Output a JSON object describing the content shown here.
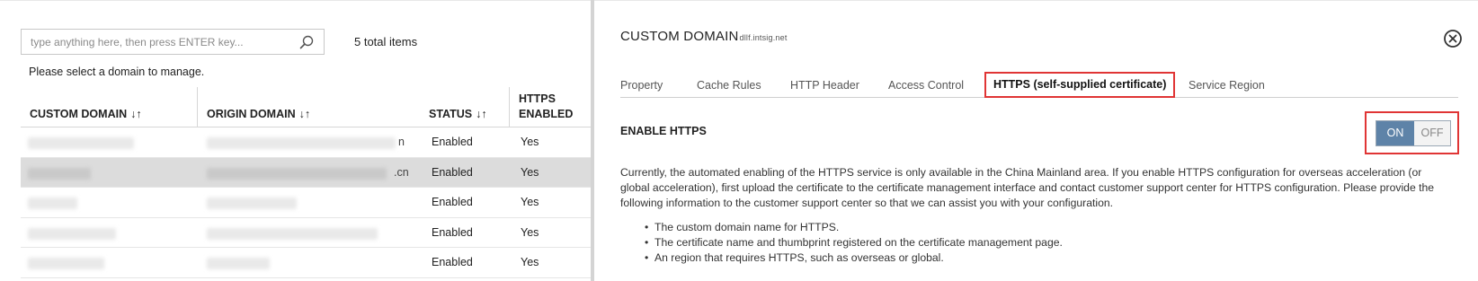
{
  "left": {
    "search": {
      "placeholder": "type anything here, then press ENTER key...",
      "value": ""
    },
    "total_items": "5 total items",
    "select_message": "Please select a domain to manage.",
    "columns": [
      {
        "label": "CUSTOM DOMAIN",
        "sort": "↓↑"
      },
      {
        "label": "ORIGIN DOMAIN",
        "sort": "↓↑"
      },
      {
        "label": "STATUS",
        "sort": "↓↑"
      },
      {
        "label_line1": "HTTPS",
        "label_line2": "ENABLED"
      }
    ],
    "rows": [
      {
        "origin_tail": "n",
        "status": "Enabled",
        "https": "Yes",
        "selected": false
      },
      {
        "origin_tail": ".cn",
        "status": "Enabled",
        "https": "Yes",
        "selected": true
      },
      {
        "origin_tail": "",
        "status": "Enabled",
        "https": "Yes",
        "selected": false
      },
      {
        "origin_tail": "",
        "status": "Enabled",
        "https": "Yes",
        "selected": false
      },
      {
        "origin_tail": "",
        "status": "Enabled",
        "https": "Yes",
        "selected": false
      }
    ]
  },
  "panel": {
    "title": "CUSTOM DOMAIN",
    "subtitle": "dllf.intsig.net",
    "tabs": [
      {
        "label": "Property"
      },
      {
        "label": "Cache Rules"
      },
      {
        "label": "HTTP Header"
      },
      {
        "label": "Access Control"
      },
      {
        "label": "HTTPS (self-supplied certificate)",
        "active": true
      },
      {
        "label": "Service Region"
      }
    ],
    "enable_https": {
      "label": "ENABLE HTTPS",
      "on_label": "ON",
      "off_label": "OFF",
      "state": "ON"
    },
    "description": "Currently, the automated enabling of the HTTPS service is only available in the China Mainland area. If you enable HTTPS configuration for overseas acceleration (or global acceleration), first upload the certificate to the certificate management interface and contact customer support center for HTTPS configuration. Please provide the following information to the customer support center so that we can assist you with your configuration.",
    "bullets": [
      "The custom domain name for HTTPS.",
      "The certificate name and thumbprint registered on the certificate management page.",
      "An region that requires HTTPS, such as overseas or global."
    ]
  },
  "colors": {
    "highlight": "#e03535",
    "toggle_on": "#5e83a8",
    "selected_row": "#dcdcdc"
  }
}
